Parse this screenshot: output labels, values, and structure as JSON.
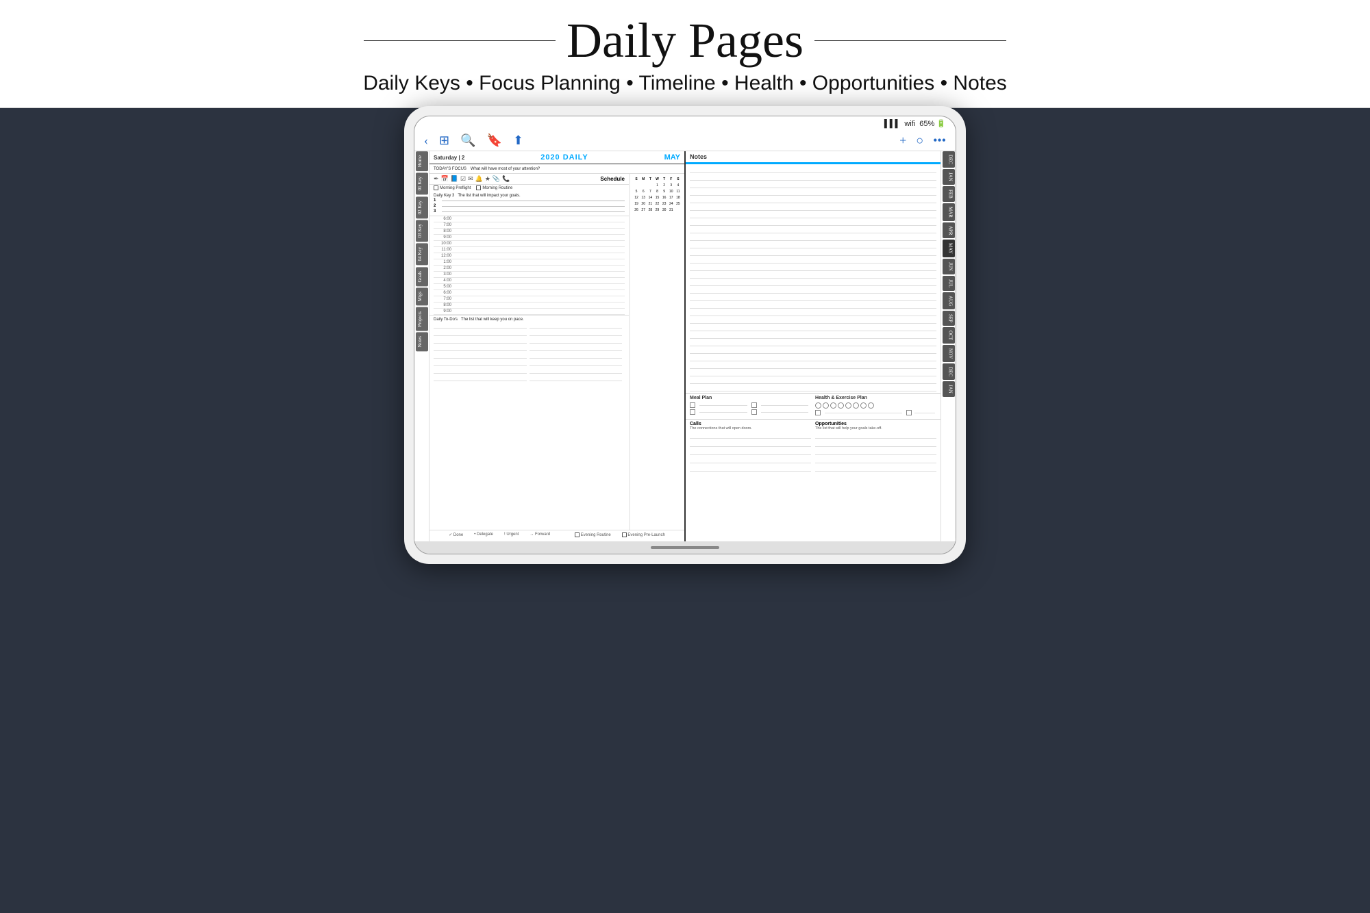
{
  "header": {
    "title": "Daily Pages",
    "subtitle": "Daily Keys • Focus Planning • Timeline • Health • Opportunities • Notes"
  },
  "device": {
    "statusBar": {
      "battery": "65%",
      "wifi": "wifi",
      "signal": "signal"
    },
    "navBar": {
      "back": "‹",
      "grid": "⊞",
      "search": "🔍",
      "bookmark": "🔖",
      "share": "⬆",
      "plus": "+",
      "circle": "○",
      "more": "•••"
    }
  },
  "planner": {
    "leftPage": {
      "date": "Saturday | 2",
      "year": "2020 DAILY",
      "month": "MAY",
      "focus": {
        "label": "TODAY'S FOCUS",
        "sublabel": "What will have most of your attention?"
      },
      "scheduleLabel": "Schedule",
      "morningChecks": [
        "Morning Preflight",
        "Morning Routine"
      ],
      "dailyKey": {
        "label": "Daily Key 3",
        "sublabel": "The list that will impact your goals.",
        "items": [
          "1",
          "2",
          "3"
        ]
      },
      "timeSlots": [
        "6:00",
        "7:00",
        "8:00",
        "9:00",
        "10:00",
        "11:00",
        "12:00",
        "1:00",
        "2:00",
        "3:00",
        "4:00",
        "5:00",
        "6:00",
        "7:00",
        "8:00",
        "9:00"
      ],
      "todoSection": {
        "label": "Daily To-Do's",
        "sublabel": "The list that will keep you on pace."
      },
      "footerLegend": [
        "✓ Done",
        "• Delegate",
        "! Urgent",
        "→ Forward"
      ],
      "eveningChecks": [
        "Evening Routine",
        "Evening Pre-Launch"
      ]
    },
    "rightPage": {
      "notesLabel": "Notes",
      "mealPlan": "Meal Plan",
      "healthPlan": "Health & Exercise Plan",
      "calls": {
        "label": "Calls",
        "sublabel": "The connections that will open doors."
      },
      "opportunities": {
        "label": "Opportunities",
        "sublabel": "The list that will help your goals take-off."
      }
    },
    "leftTabs": [
      "Home",
      "01 Key",
      "02 Key",
      "03 Key",
      "04 Key",
      "Goals",
      "Mtgs",
      "Projects",
      "Notes"
    ],
    "rightTabs": [
      "DEC",
      "JAN",
      "FEB",
      "MAR",
      "APR",
      "MAY",
      "JUN",
      "JUL",
      "AUG",
      "SEP",
      "OCT",
      "NOV",
      "DEC",
      "JAN"
    ]
  },
  "miniCal": {
    "headers": [
      "S",
      "M",
      "T",
      "W",
      "T",
      "F",
      "S"
    ],
    "rows": [
      [
        "",
        "",
        "",
        "1",
        "2",
        "3",
        "4"
      ],
      [
        "5",
        "6",
        "7",
        "8",
        "9",
        "10",
        "11"
      ],
      [
        "12",
        "13",
        "14",
        "15",
        "16",
        "17",
        "18"
      ],
      [
        "19",
        "20",
        "21",
        "22",
        "23",
        "24",
        "25"
      ],
      [
        "26",
        "27",
        "28",
        "29",
        "30",
        "31",
        ""
      ]
    ]
  }
}
